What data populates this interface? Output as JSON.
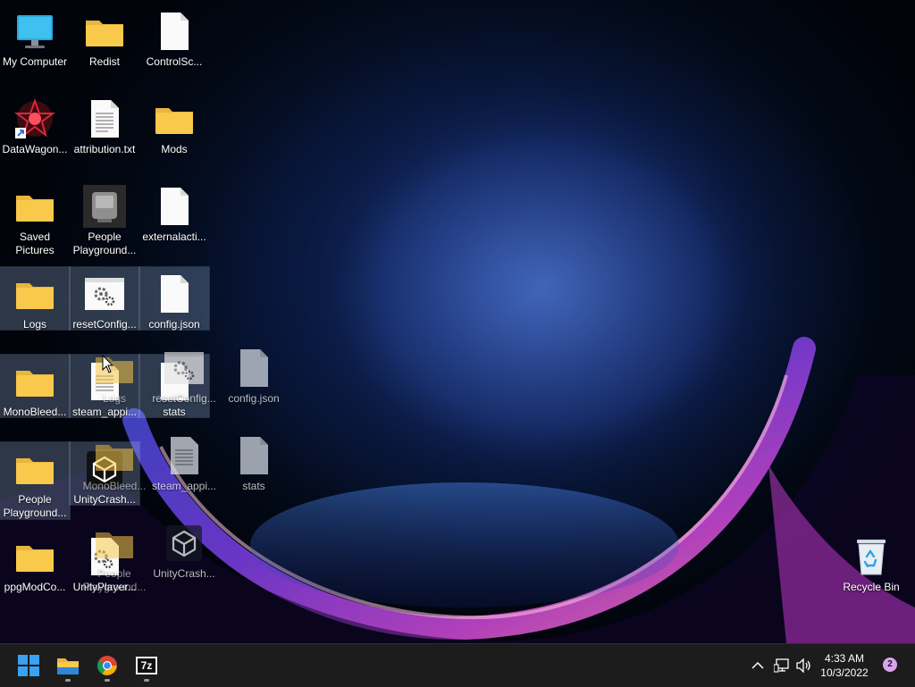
{
  "desktop": {
    "icons": [
      {
        "label": "My Computer",
        "type": "computer"
      },
      {
        "label": "Redist",
        "type": "folder"
      },
      {
        "label": "ControlSc...",
        "type": "file"
      },
      {
        "label": "DataWagon...",
        "type": "shortcut-app"
      },
      {
        "label": "attribution.txt",
        "type": "text-file"
      },
      {
        "label": "Mods",
        "type": "folder"
      },
      {
        "label": "Saved Pictures",
        "type": "folder"
      },
      {
        "label": "People Playground...",
        "type": "app"
      },
      {
        "label": "externalacti...",
        "type": "file"
      },
      {
        "label": "Logs",
        "type": "folder"
      },
      {
        "label": "resetConfig...",
        "type": "settings-file"
      },
      {
        "label": "config.json",
        "type": "file"
      },
      {
        "label": "MonoBleed...",
        "type": "folder"
      },
      {
        "label": "steam_appi...",
        "type": "text-file"
      },
      {
        "label": "stats",
        "type": "file"
      },
      {
        "label": "People Playground...",
        "type": "folder"
      },
      {
        "label": "UnityCrash...",
        "type": "unity-app"
      },
      {
        "label": "ppgModCo...",
        "type": "folder"
      },
      {
        "label": "UnityPlayer...",
        "type": "settings-file"
      },
      {
        "label": "Recycle Bin",
        "type": "recycle-bin"
      }
    ],
    "drag_preview": [
      {
        "label": "Logs",
        "type": "folder"
      },
      {
        "label": "resetConfig...",
        "type": "settings-file"
      },
      {
        "label": "config.json",
        "type": "file"
      },
      {
        "label": "MonoBleed...",
        "type": "folder"
      },
      {
        "label": "steam_appi...",
        "type": "text-file"
      },
      {
        "label": "stats",
        "type": "file"
      },
      {
        "label": "People Playground...",
        "type": "folder"
      },
      {
        "label": "UnityCrash...",
        "type": "unity-app"
      }
    ]
  },
  "taskbar": {
    "apps": [
      {
        "name": "Start",
        "icon": "windows-logo-icon"
      },
      {
        "name": "File Explorer",
        "icon": "file-explorer-icon"
      },
      {
        "name": "Google Chrome",
        "icon": "chrome-icon"
      },
      {
        "name": "7-Zip",
        "icon": "7zip-icon",
        "text": "7z"
      }
    ],
    "tray": {
      "chevron": "chevron-up-icon",
      "network": "network-icon",
      "volume": "volume-icon"
    },
    "clock": {
      "time": "4:33 AM",
      "date": "10/3/2022"
    },
    "notification_count": "2"
  },
  "colors": {
    "taskbar_bg": "#1c1c1c",
    "folder_yellow": "#f8c94a",
    "start_blue": "#3aa0f0",
    "selection": "#a0bee6"
  }
}
